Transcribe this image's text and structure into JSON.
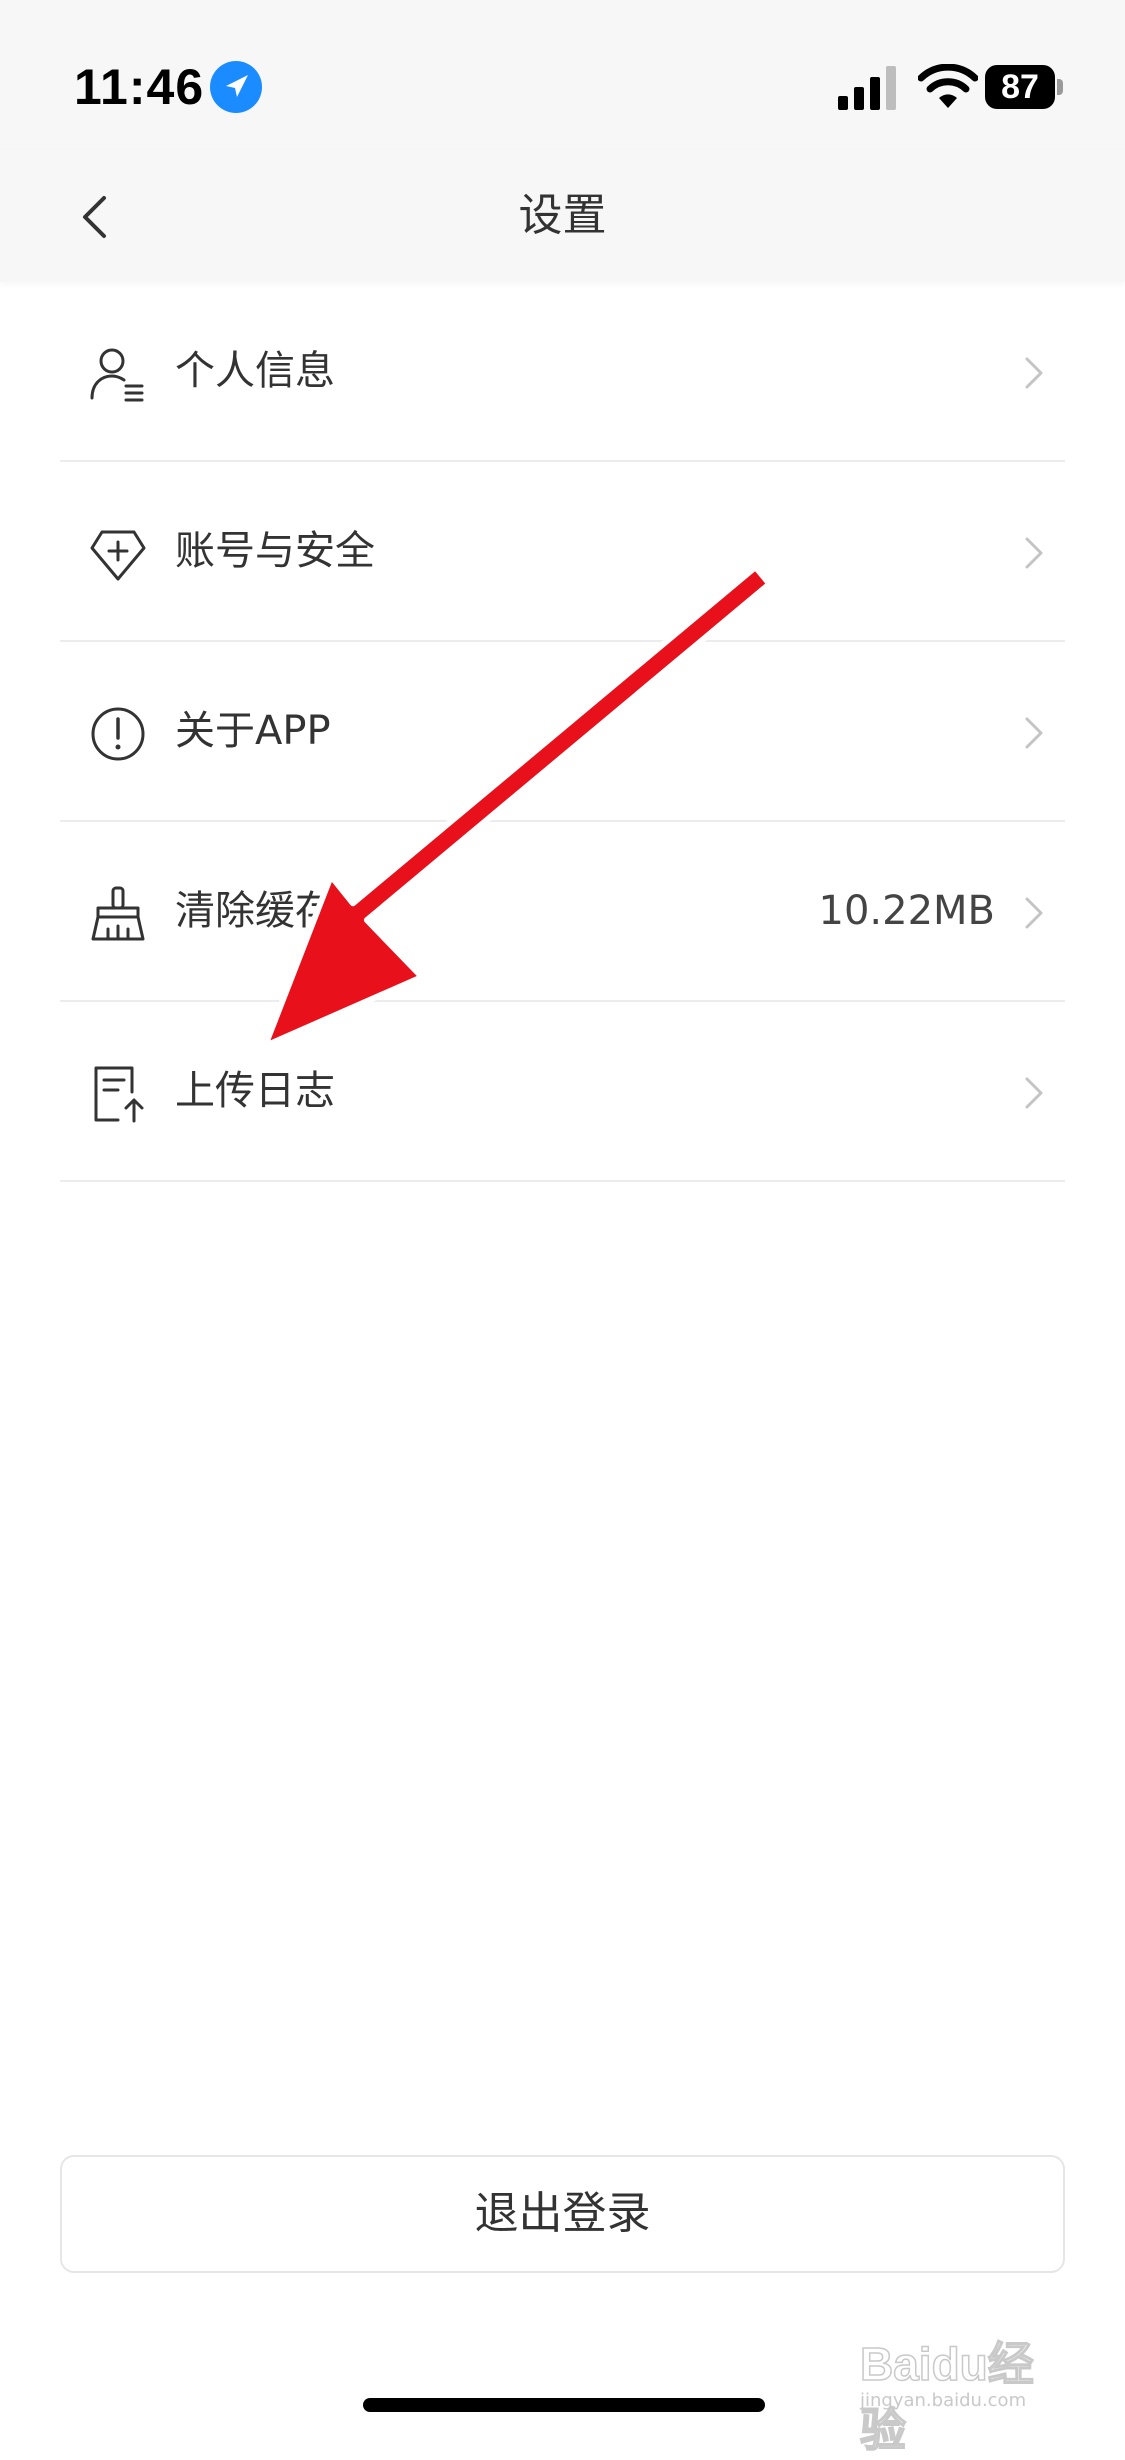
{
  "status_bar": {
    "time": "11:46",
    "battery": "87"
  },
  "nav": {
    "title": "设置"
  },
  "settings": {
    "items": [
      {
        "label": "个人信息",
        "value": ""
      },
      {
        "label": "账号与安全",
        "value": ""
      },
      {
        "label": "关于APP",
        "value": ""
      },
      {
        "label": "清除缓存",
        "value": "10.22MB"
      },
      {
        "label": "上传日志",
        "value": ""
      }
    ]
  },
  "logout_label": "退出登录",
  "watermark": {
    "brand": "Baidu经验",
    "url": "jingyan.baidu.com"
  },
  "colors": {
    "annotation_arrow": "#e8101a",
    "location_icon": "#1a8cff"
  }
}
